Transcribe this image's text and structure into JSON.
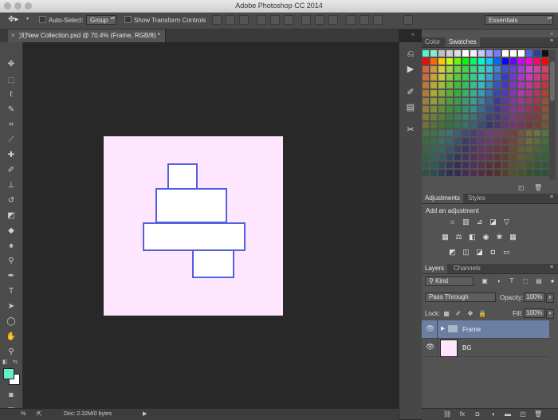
{
  "window": {
    "title": "Adobe Photoshop CC 2014"
  },
  "options_bar": {
    "auto_select_label": "Auto-Select:",
    "auto_select_value": "Group",
    "transform_label": "Show Transform Controls",
    "workspace": "Essentials"
  },
  "document_tab": {
    "close": "×",
    "title": "3 New Collection.psd @ 70.4% (Frame, RGB/8) *"
  },
  "status_bar": {
    "zoom": "%",
    "doc_info": "Doc: 2.32M/0 bytes"
  },
  "colors": {
    "foreground": "#5ff0c8",
    "background": "#ffffff",
    "shape_stroke": "#5360e0",
    "canvas_fill": "#fde6fe"
  },
  "swatches_panel": {
    "tabs": [
      "Color",
      "Swatches"
    ],
    "active": "Swatches"
  },
  "adjustments_panel": {
    "tabs": [
      "Adjustments",
      "Styles"
    ],
    "active": "Adjustments",
    "heading": "Add an adjustment"
  },
  "layers_panel": {
    "tabs": [
      "Layers",
      "Channels"
    ],
    "active": "Layers",
    "filter": "Kind",
    "blend_mode": "Pass Through",
    "opacity_label": "Opacity:",
    "opacity_value": "100%",
    "lock_label": "Lock:",
    "fill_label": "Fill:",
    "fill_value": "100%",
    "layers": [
      {
        "name": "Frame",
        "type": "group",
        "selected": true
      },
      {
        "name": "BG",
        "type": "layer",
        "selected": false
      }
    ]
  }
}
